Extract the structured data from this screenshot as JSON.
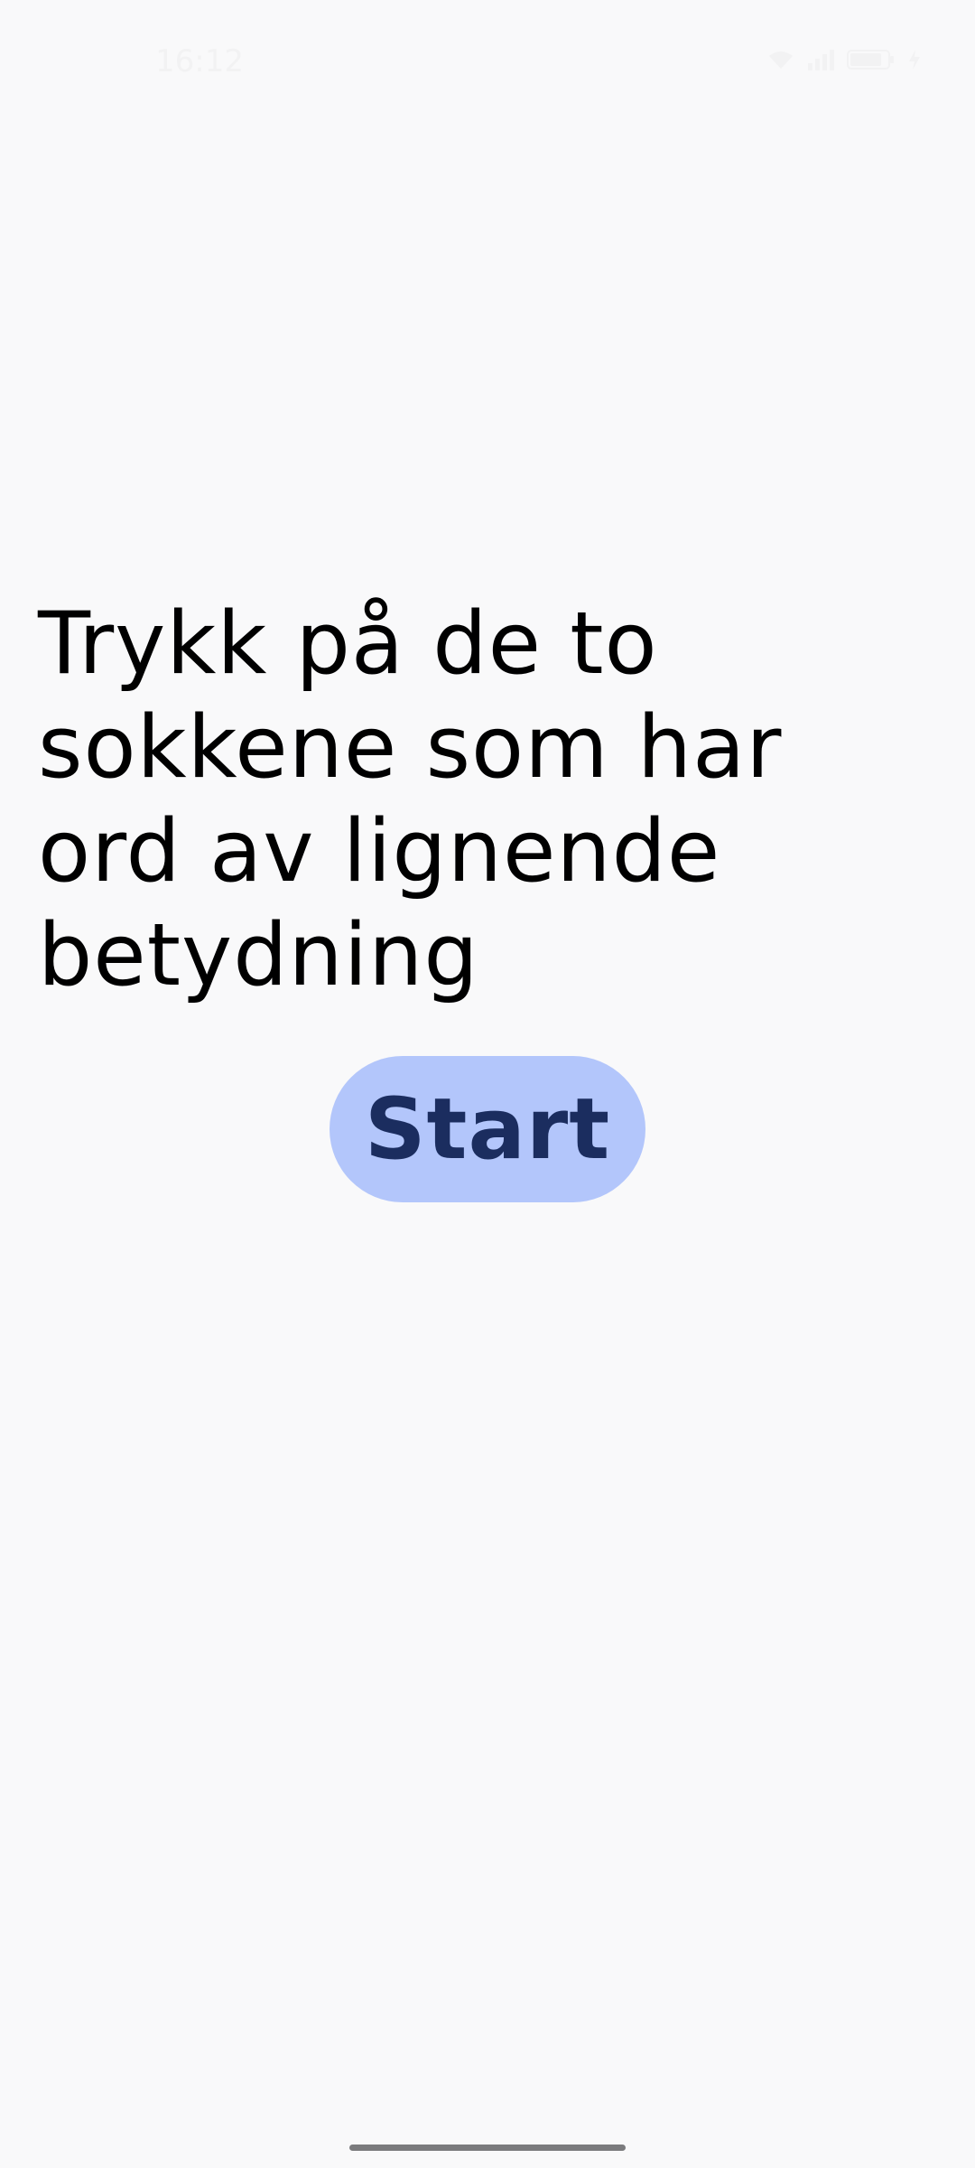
{
  "status_bar": {
    "time": "16:12",
    "icons": [
      "wifi-icon",
      "signal-icon",
      "battery-icon",
      "charging-icon"
    ]
  },
  "main": {
    "instruction": "Trykk på de to sokkene som har ord av lignende betydning",
    "start_label": "Start"
  },
  "colors": {
    "background": "#f9f9fa",
    "button_background": "#b3c6fb",
    "button_text": "#1b2d5f",
    "text": "#000000"
  }
}
